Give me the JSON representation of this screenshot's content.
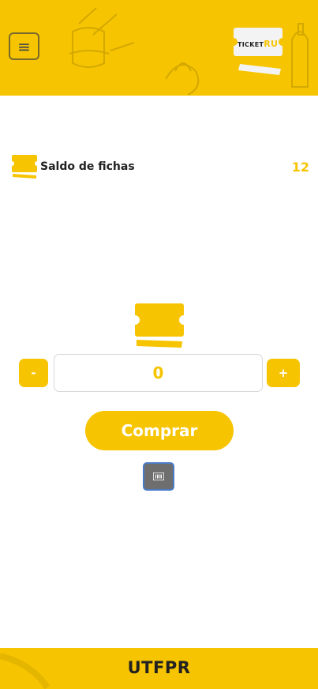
{
  "header": {
    "menu_icon": "hamburger-menu-icon",
    "logo": {
      "text_prefix": "TICKET",
      "text_suffix": "RU"
    }
  },
  "balance": {
    "label": "Saldo de fichas",
    "value": "12",
    "icon": "ticket-icon"
  },
  "purchase": {
    "ticket_icon": "ticket-icon",
    "minus_label": "-",
    "plus_label": "+",
    "quantity": "0",
    "buy_label": "Comprar",
    "barcode_icon": "barcode-icon"
  },
  "footer": {
    "label": "UTFPR"
  },
  "colors": {
    "accent": "#F6C400",
    "text": "#222222",
    "barcode_bg": "#6e6e6e"
  }
}
